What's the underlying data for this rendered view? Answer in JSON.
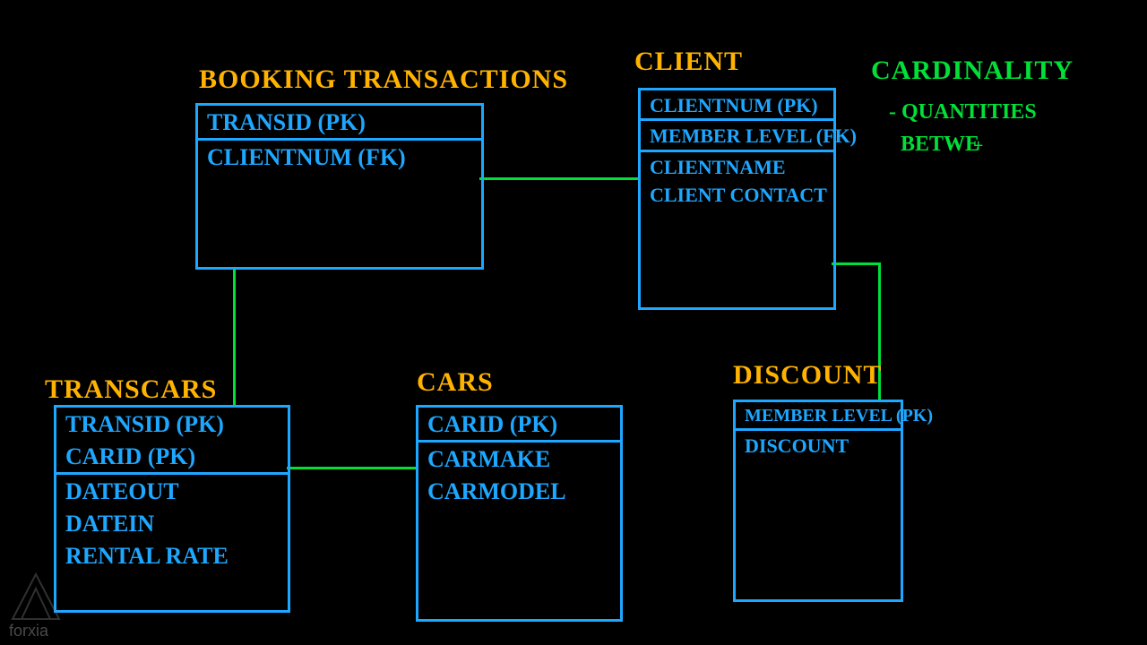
{
  "diagram": {
    "booking_transactions": {
      "title": "BOOKING TRANSACTIONS",
      "pk": "TRANSID (PK)",
      "fields": [
        "CLIENTNUM (FK)"
      ]
    },
    "client": {
      "title": "CLIENT",
      "pk": "CLIENTNUM (PK)",
      "fields": [
        "MEMBER LEVEL (FK)",
        "CLIENTNAME",
        "CLIENT CONTACT"
      ]
    },
    "transcars": {
      "title": "TRANSCARS",
      "pk1": "TRANSID (PK)",
      "pk2": "CARID (PK)",
      "fields": [
        "DATEOUT",
        "DATEIN",
        "RENTAL RATE"
      ]
    },
    "cars": {
      "title": "CARS",
      "pk": "CARID (PK)",
      "fields": [
        "CARMAKE",
        "CARMODEL"
      ]
    },
    "discount": {
      "title": "DISCOUNT",
      "pk": "MEMBER LEVEL (PK)",
      "fields": [
        "DISCOUNT"
      ]
    },
    "side": {
      "heading": "CARDINALITY",
      "note1": "- QUANTITIES",
      "note2": "BETWE"
    },
    "logo_text": "forxia"
  }
}
